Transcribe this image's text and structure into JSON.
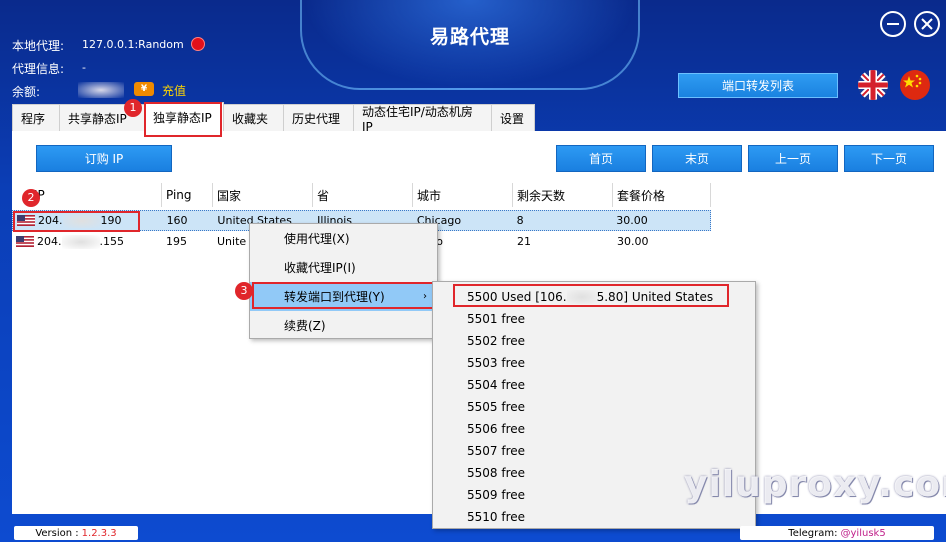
{
  "window": {
    "title": "易路代理",
    "minimize_icon": "minimize-icon",
    "close_icon": "close-icon"
  },
  "info": {
    "local_proxy_label": "本地代理:",
    "local_proxy_value": "127.0.0.1:Random",
    "proxy_info_label": "代理信息:",
    "proxy_info_value": "-",
    "balance_label": "余额:",
    "coin_symbol": "¥",
    "recharge_label": "充值",
    "status_color": "#e3101b"
  },
  "header": {
    "port_forward_list_label": "端口转发列表",
    "lang_en": "english-flag-icon",
    "lang_zh": "chinese-flag-icon"
  },
  "tabs": [
    {
      "label": "程序"
    },
    {
      "label": "共享静态IP"
    },
    {
      "label": "独享静态IP",
      "active": true
    },
    {
      "label": "收藏夹"
    },
    {
      "label": "历史代理"
    },
    {
      "label": "动态住宅IP/动态机房IP"
    },
    {
      "label": "设置"
    }
  ],
  "toolbar": {
    "order_ip_label": "订购 IP",
    "first_page_label": "首页",
    "last_page_label": "末页",
    "prev_page_label": "上一页",
    "next_page_label": "下一页"
  },
  "table": {
    "columns": [
      "代理IP",
      "Ping",
      "国家",
      "省",
      "城市",
      "剩余天数",
      "套餐价格"
    ],
    "header_visible_ip": "IP",
    "rows": [
      {
        "ip_start": "204.",
        "ip_end": "190",
        "ping": "160",
        "country": "United States",
        "province": "Illinois",
        "city": "Chicago",
        "days": "8",
        "price": "30.00"
      },
      {
        "ip_start": "204.",
        "ip_end": ".155",
        "ping": "195",
        "country": "United States",
        "province": "",
        "city": "Chicago",
        "days": "21",
        "price": "30.00"
      }
    ],
    "row2_country_visible": "Unite",
    "row2_city_visible": "cago"
  },
  "context_menu": {
    "items": [
      {
        "label": "使用代理(X)"
      },
      {
        "label": "收藏代理IP(I)"
      },
      {
        "label": "转发端口到代理(Y)",
        "has_submenu": true
      },
      {
        "label": "续费(Z)"
      }
    ],
    "submenu_arrow": "›"
  },
  "submenu": {
    "items": [
      {
        "label_start": "5500 Used [106.",
        "label_end": "5.80] United States"
      },
      {
        "label": "5501 free"
      },
      {
        "label": "5502 free"
      },
      {
        "label": "5503 free"
      },
      {
        "label": "5504 free"
      },
      {
        "label": "5505 free"
      },
      {
        "label": "5506 free"
      },
      {
        "label": "5507 free"
      },
      {
        "label": "5508 free"
      },
      {
        "label": "5509 free"
      },
      {
        "label": "5510 free"
      }
    ]
  },
  "annotations": {
    "step1": "1",
    "step2": "2",
    "step3": "3",
    "highlight_color": "#e0262b"
  },
  "footer": {
    "version_label": "Version :",
    "version_value": "1.2.3.3",
    "telegram_label": "Telegram:",
    "telegram_value": "@yilusk5"
  },
  "watermark": "yiluproxy.com"
}
